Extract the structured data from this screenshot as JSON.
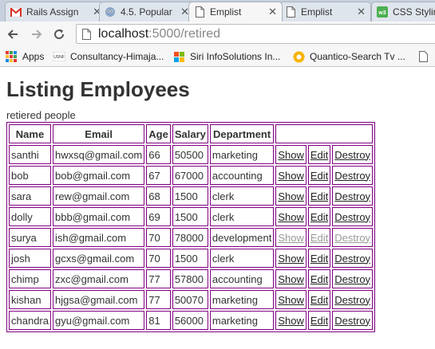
{
  "browser": {
    "tabs": [
      {
        "title": "Rails Assign",
        "icon": "gmail-icon"
      },
      {
        "title": "4.5. Popular",
        "icon": "mascot-icon"
      },
      {
        "title": "Emplist",
        "icon": "page-icon",
        "active": true
      },
      {
        "title": "Emplist",
        "icon": "page-icon"
      },
      {
        "title": "CSS Styling",
        "icon": "w3schools-icon"
      }
    ],
    "url_host": "localhost",
    "url_rest": ":5000/retired",
    "bookmarks": [
      {
        "label": "Apps",
        "icon": "apps-grid-icon"
      },
      {
        "label": "Consultancy-Himaja...",
        "icon": "usnf-logo-icon"
      },
      {
        "label": "Siri InfoSolutions In...",
        "icon": "windows-logo-icon"
      },
      {
        "label": "Quantico-Search Tv ...",
        "icon": "quantico-logo-icon"
      }
    ]
  },
  "page": {
    "title": "Listing Employees",
    "subtitle": "retiered people",
    "columns": [
      "Name",
      "Email",
      "Age",
      "Salary",
      "Department",
      ""
    ],
    "actions": {
      "show": "Show",
      "edit": "Edit",
      "destroy": "Destroy"
    },
    "rows": [
      {
        "name": "santhi",
        "email": "hwxsq@gmail.com",
        "age": "66",
        "salary": "50500",
        "department": "marketing"
      },
      {
        "name": "bob",
        "email": "bob@gmail.com",
        "age": "67",
        "salary": "67000",
        "department": "accounting"
      },
      {
        "name": "sara",
        "email": "rew@gmail.com",
        "age": "68",
        "salary": "1500",
        "department": "clerk"
      },
      {
        "name": "dolly",
        "email": "bbb@gmail.com",
        "age": "69",
        "salary": "1500",
        "department": "clerk"
      },
      {
        "name": "surya",
        "email": "ish@gmail.com",
        "age": "70",
        "salary": "78000",
        "department": "development",
        "visited": true
      },
      {
        "name": "josh",
        "email": "gcxs@gmail.com",
        "age": "70",
        "salary": "1500",
        "department": "clerk"
      },
      {
        "name": "chimp",
        "email": "zxc@gmail.com",
        "age": "77",
        "salary": "57800",
        "department": "accounting"
      },
      {
        "name": "kishan",
        "email": "hjgsa@gmail.com",
        "age": "77",
        "salary": "50070",
        "department": "marketing"
      },
      {
        "name": "chandra",
        "email": "gyu@gmail.com",
        "age": "81",
        "salary": "56000",
        "department": "marketing"
      }
    ]
  },
  "colors": {
    "table_border": "#800080",
    "tab_bar": "#c6d0dc"
  }
}
